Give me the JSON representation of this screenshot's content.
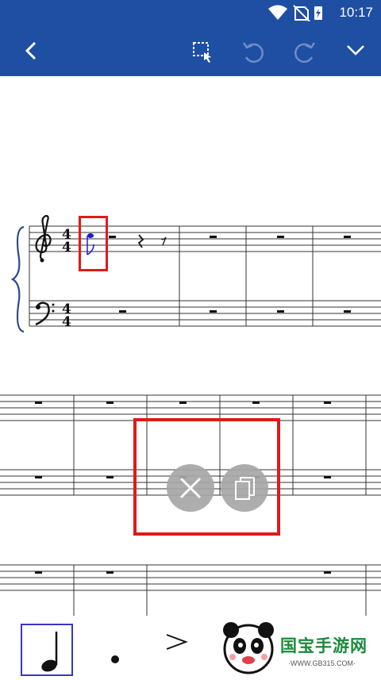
{
  "status_bar": {
    "time": "10:17"
  },
  "toolbar": {
    "buttons": [
      {
        "name": "back",
        "icon": "chevron-left-icon"
      },
      {
        "name": "select",
        "icon": "marquee-select-icon"
      },
      {
        "name": "undo",
        "icon": "undo-icon"
      },
      {
        "name": "redo",
        "icon": "redo-icon"
      },
      {
        "name": "collapse",
        "icon": "chevron-down-icon"
      }
    ]
  },
  "score": {
    "time_signature": {
      "top": "4",
      "bottom": "4"
    },
    "clefs": [
      "treble-clef",
      "bass-clef"
    ],
    "selected_note_color": "#1a1ad6",
    "selection_color": "#e01a1a"
  },
  "selection_actions": [
    {
      "name": "delete",
      "icon": "close-icon"
    },
    {
      "name": "copy",
      "icon": "copy-icon"
    }
  ],
  "palette": {
    "items": [
      {
        "name": "quarter-note",
        "icon": "quarter-note-icon",
        "selected": true
      },
      {
        "name": "dot",
        "icon": "dot-icon",
        "selected": false
      },
      {
        "name": "accent",
        "icon": "accent-icon",
        "selected": false
      }
    ]
  },
  "watermark": {
    "text": "国宝手游网",
    "url": "·WWW.GB315.COM·"
  },
  "colors": {
    "primary": "#1f4fa3",
    "selection": "#e01a1a",
    "note_selected": "#1a1ad6",
    "palette_selected": "#3a33c9",
    "fab": "#a7a7a7"
  }
}
